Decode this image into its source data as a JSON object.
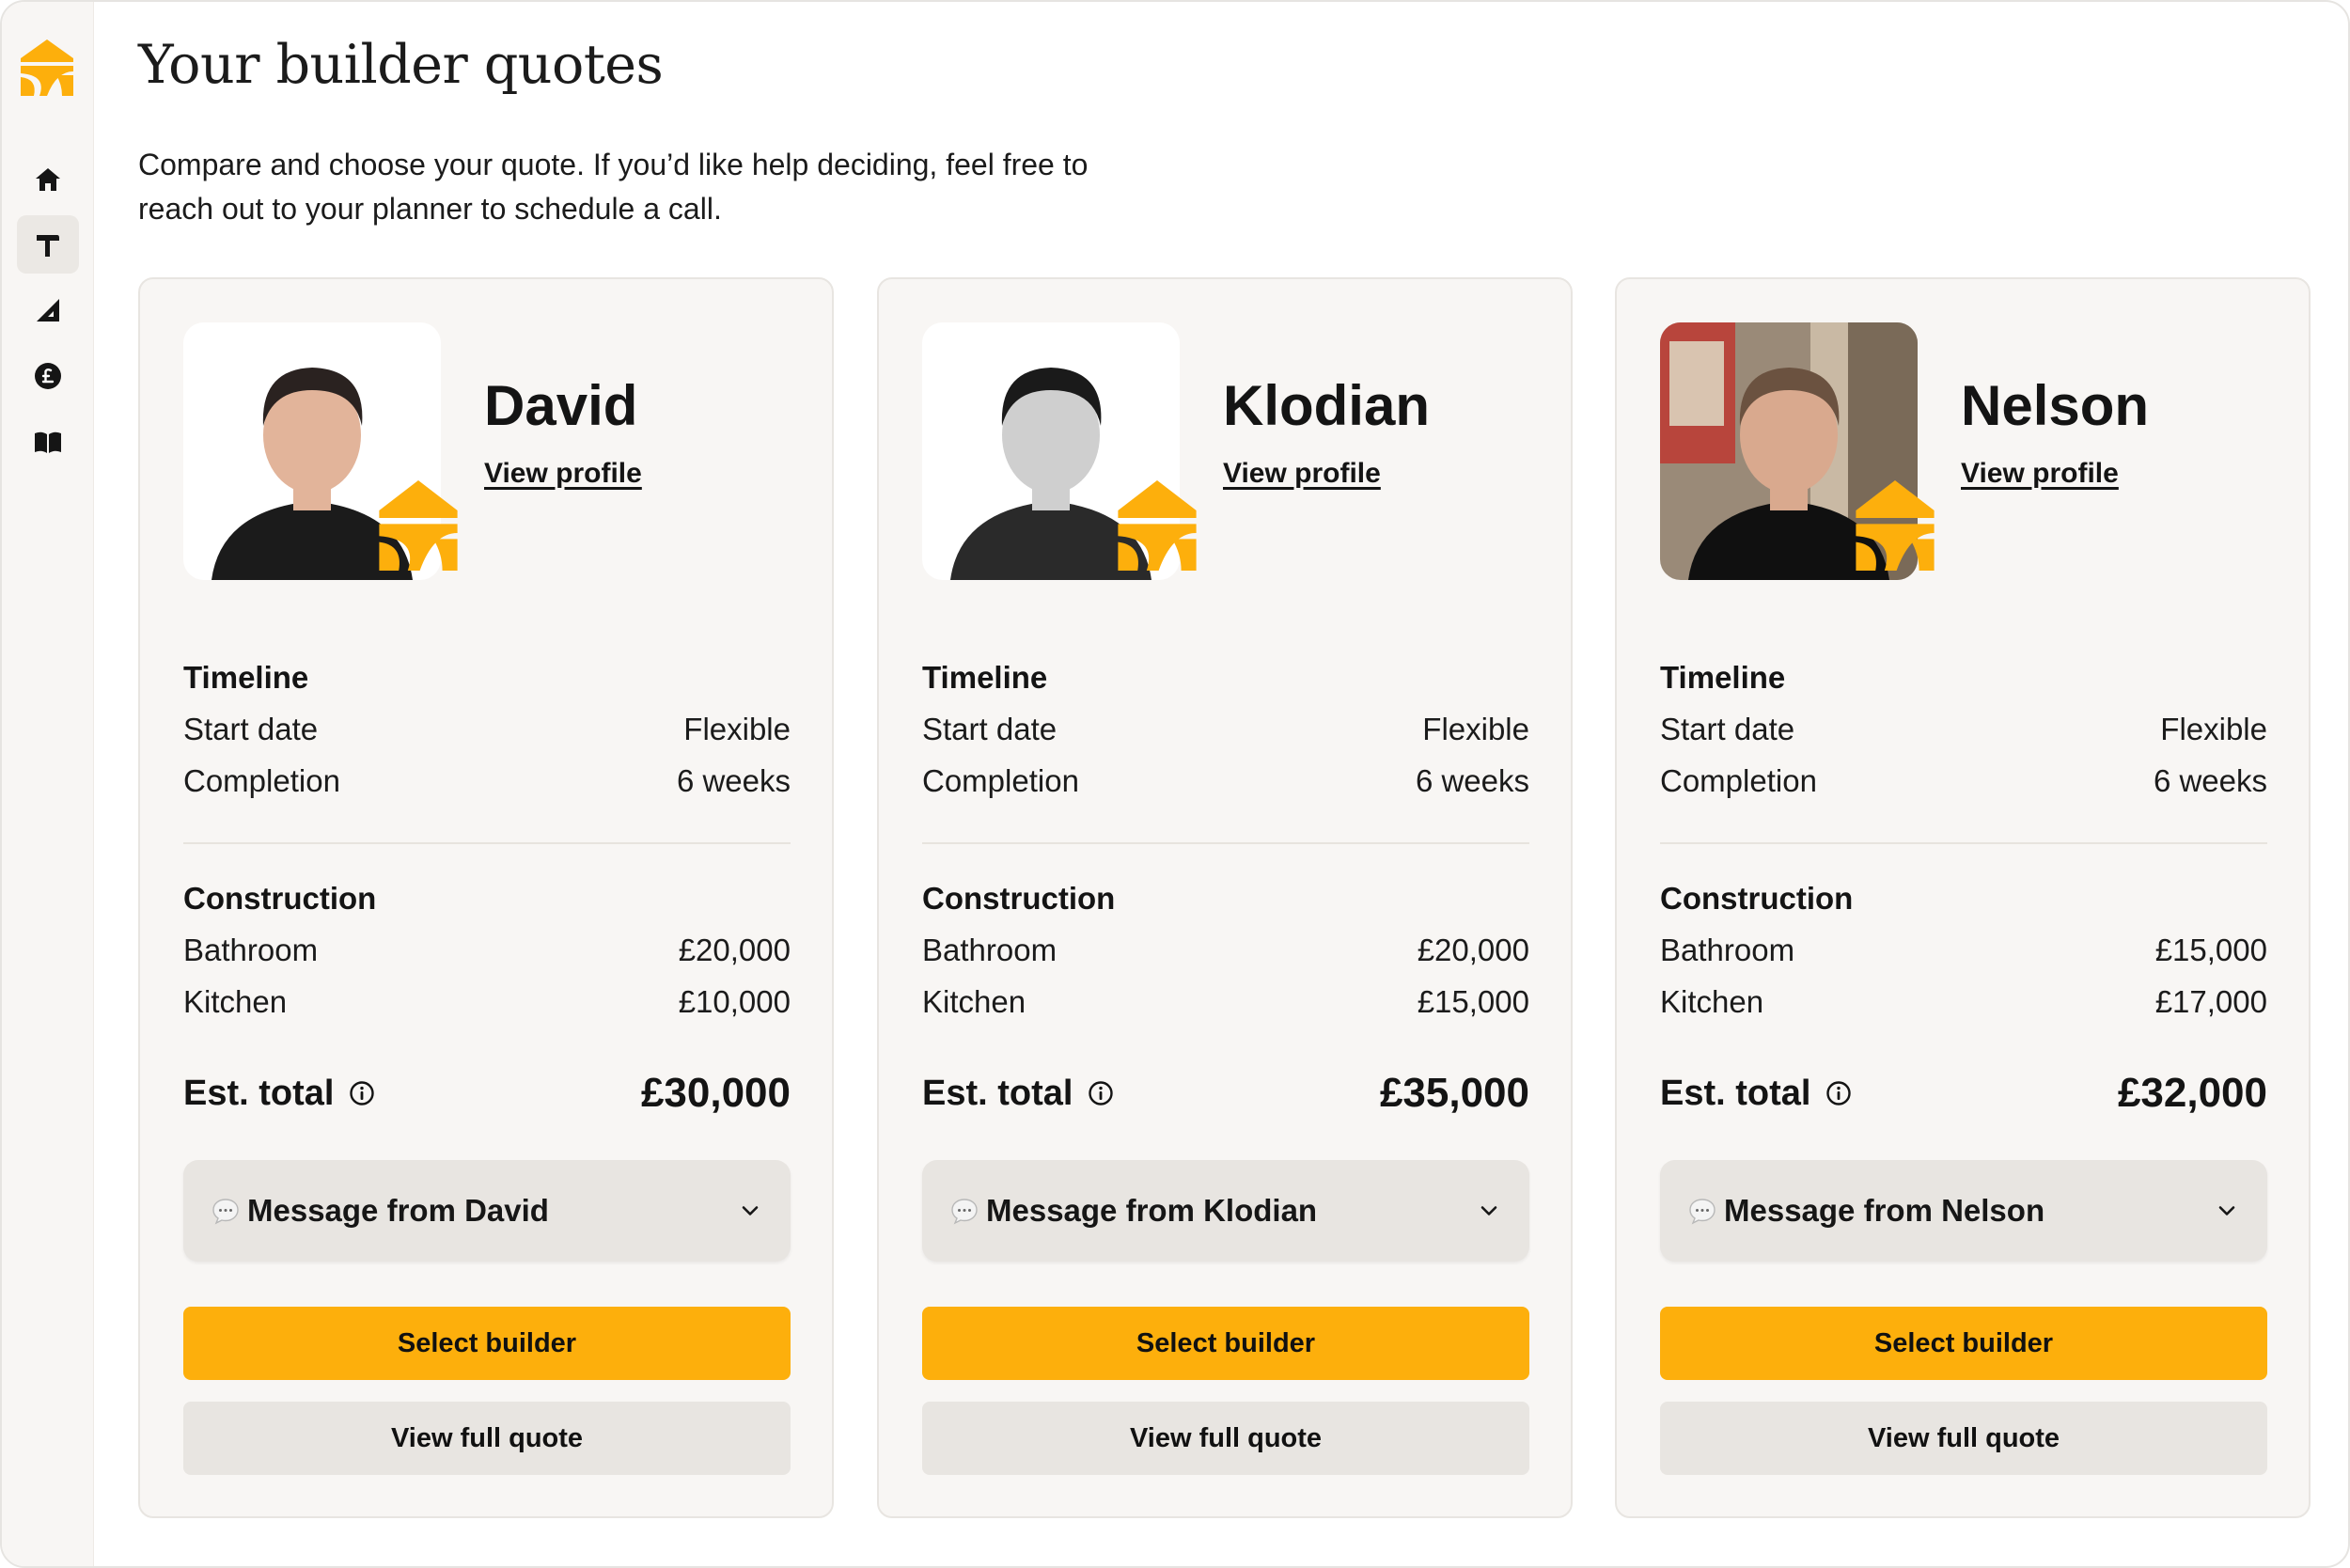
{
  "header": {
    "title": "Your builder quotes",
    "intro_line1": "Compare and choose your quote. If you’d like help deciding, feel free to",
    "intro_line2": "reach out to your planner to schedule a call."
  },
  "sidebar": {
    "items": [
      {
        "icon": "home-icon",
        "active": false
      },
      {
        "icon": "hammer-icon",
        "active": true
      },
      {
        "icon": "ruler-icon",
        "active": false
      },
      {
        "icon": "pound-icon",
        "active": false
      },
      {
        "icon": "book-icon",
        "active": false
      }
    ]
  },
  "colors": {
    "accent": "#FDAF0C",
    "card_bg": "#F8F6F4",
    "button_grey": "#E8E5E1"
  },
  "labels": {
    "view_profile": "View profile",
    "timeline": "Timeline",
    "start_date": "Start date",
    "completion": "Completion",
    "construction": "Construction",
    "bathroom": "Bathroom",
    "kitchen": "Kitchen",
    "est_total": "Est. total",
    "select_builder": "Select builder",
    "view_full_quote": "View full quote"
  },
  "builders": [
    {
      "name": "David",
      "start_date": "Flexible",
      "completion": "6 weeks",
      "bathroom": "£20,000",
      "kitchen": "£10,000",
      "total": "£30,000",
      "message": "Message from David"
    },
    {
      "name": "Klodian",
      "start_date": "Flexible",
      "completion": "6 weeks",
      "bathroom": "£20,000",
      "kitchen": "£15,000",
      "total": "£35,000",
      "message": "Message from Klodian"
    },
    {
      "name": "Nelson",
      "start_date": "Flexible",
      "completion": "6 weeks",
      "bathroom": "£15,000",
      "kitchen": "£17,000",
      "total": "£32,000",
      "message": "Message from Nelson"
    }
  ]
}
